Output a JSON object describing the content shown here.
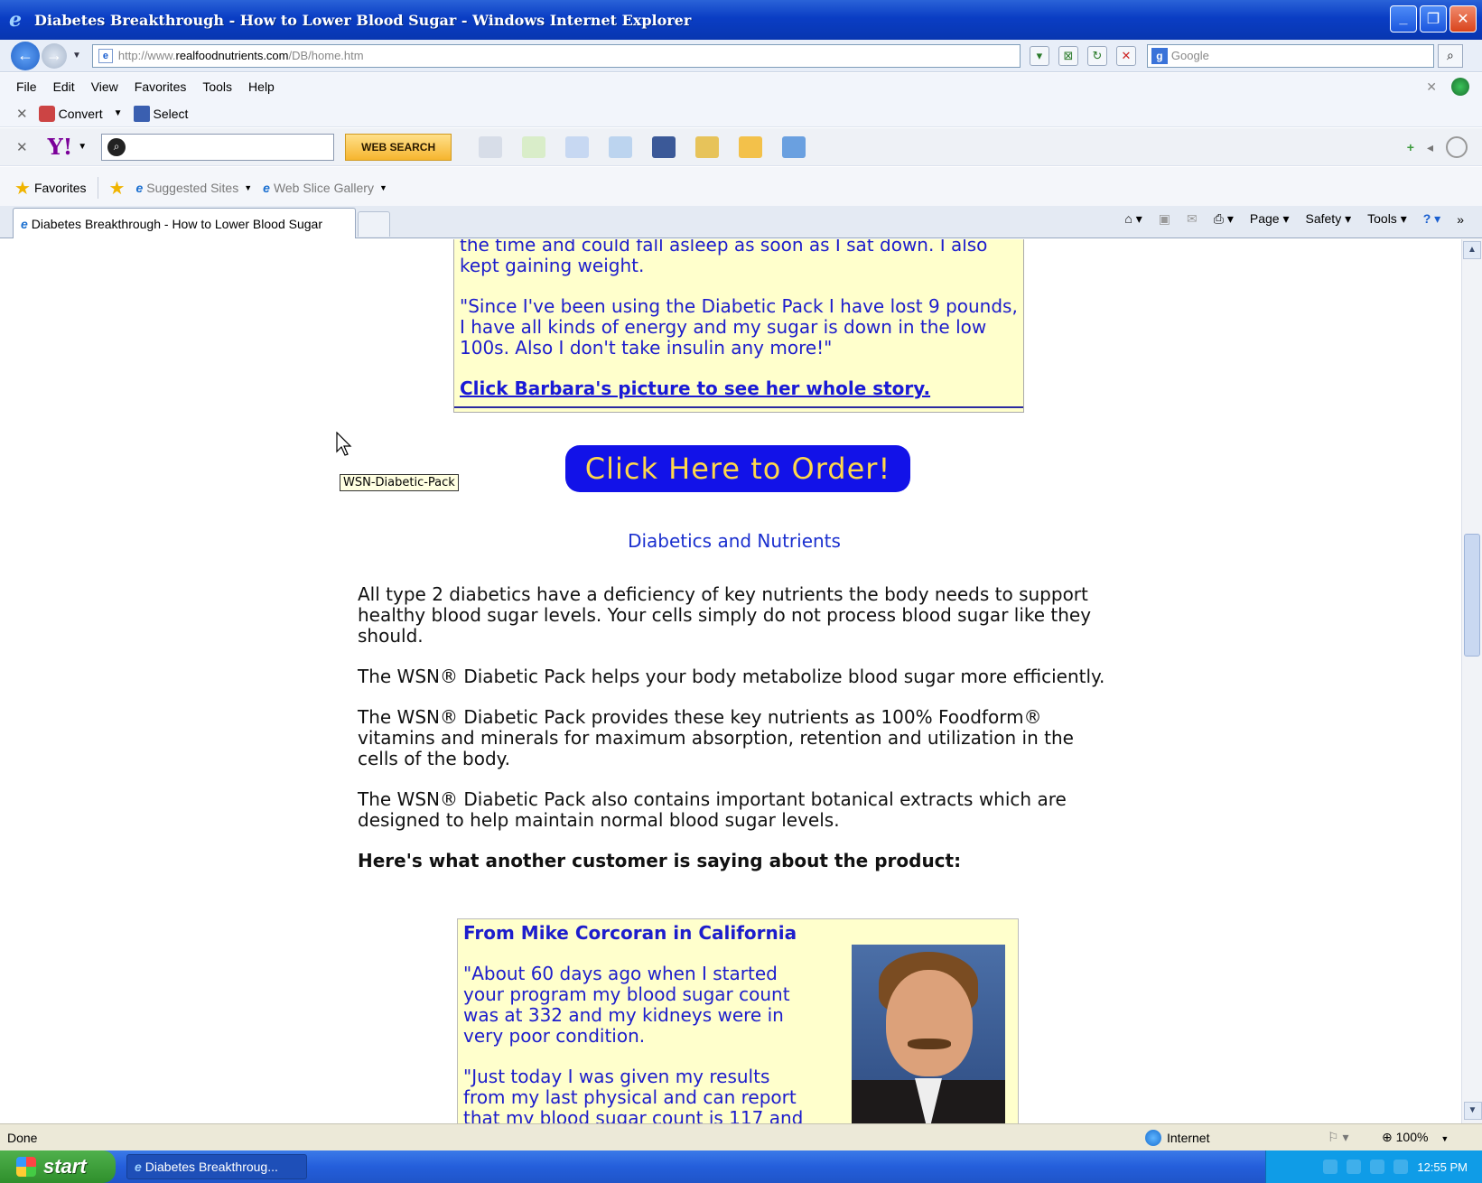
{
  "window": {
    "title": "Diabetes Breakthrough - How to Lower Blood Sugar - Windows Internet Explorer"
  },
  "address": {
    "url_prefix": "http://www.",
    "url_domain": "realfoodnutrients.com",
    "url_path": "/DB/home.htm",
    "search_placeholder": "Google"
  },
  "menu": {
    "items": [
      "File",
      "Edit",
      "View",
      "Favorites",
      "Tools",
      "Help"
    ]
  },
  "convert_bar": {
    "convert_label": "Convert",
    "select_label": "Select"
  },
  "yahoo_bar": {
    "web_search_label": "WEB SEARCH",
    "logo_text": "Y!"
  },
  "favorites_bar": {
    "favorites_label": "Favorites",
    "suggested_sites": "Suggested Sites",
    "web_slice_gallery": "Web Slice Gallery"
  },
  "tab": {
    "label": "Diabetes Breakthrough - How to Lower Blood Sugar"
  },
  "command_bar": {
    "page": "Page",
    "safety": "Safety",
    "tools": "Tools"
  },
  "content": {
    "top_testimonial": {
      "line_partial": "the time and could fall asleep as soon as I sat down. I also kept gaining weight.",
      "quote": "\"Since I've been using the Diabetic Pack I have lost 9 pounds, I have all kinds of energy and my sugar is down in the low 100s. Also I don't take insulin any more!\"",
      "link": "Click Barbara's picture to see her whole story."
    },
    "order_button": "Click Here to Order!",
    "tooltip": "WSN-Diabetic-Pack",
    "section_title": "Diabetics and Nutrients",
    "paragraphs": [
      "All type 2 diabetics have a deficiency of key nutrients the body needs to support healthy blood sugar levels. Your cells simply do not process blood sugar like they should.",
      "The WSN® Diabetic Pack helps your body metabolize blood sugar more efficiently.",
      "The WSN® Diabetic Pack provides these key nutrients as 100% Foodform® vitamins and minerals for maximum absorption, retention and utilization in the cells of the body.",
      "The WSN® Diabetic Pack also contains important botanical extracts which are designed to help maintain normal blood sugar levels."
    ],
    "customer_heading": "Here's what another customer is saying about the product:",
    "bottom_testimonial": {
      "who": "From Mike Corcoran in California",
      "quote1": "\"About 60 days ago when I started your program my blood sugar count was at 332 and my kidneys were in very poor condition.",
      "quote2": "\"Just today I was given my results from my last physical and can report that my blood sugar count is 117 and"
    }
  },
  "status": {
    "text": "Done",
    "zone": "Internet",
    "zoom": "100%"
  },
  "taskbar": {
    "start": "start",
    "task_item": "Diabetes Breakthroug...",
    "clock": "12:55 PM"
  }
}
